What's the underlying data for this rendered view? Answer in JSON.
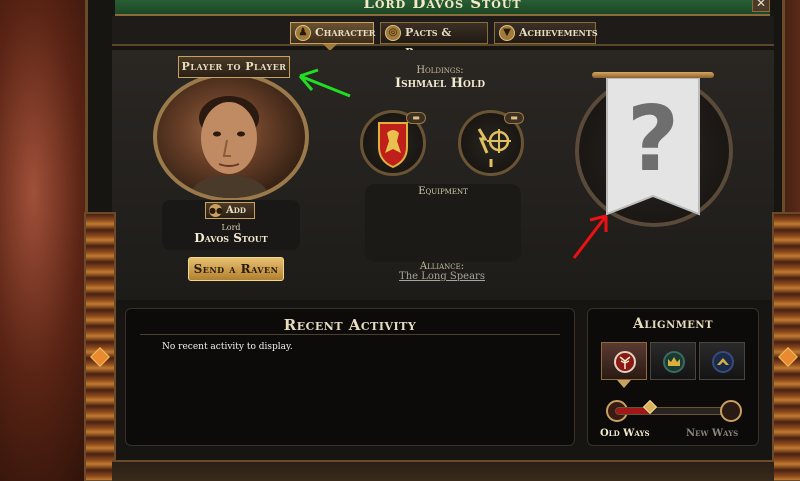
{
  "window": {
    "title": "Lord Davos Stout",
    "close_label": "✕"
  },
  "tabs": [
    {
      "label": "Character",
      "icon": "person-icon",
      "active": true
    },
    {
      "label": "Pacts & Power",
      "icon": "rings-icon",
      "active": false
    },
    {
      "label": "Achievements",
      "icon": "trophy-icon",
      "active": false
    }
  ],
  "character": {
    "player_to_player_label": "Player to Player",
    "add_label": "Add",
    "title_prefix": "Lord",
    "name": "Davos Stout",
    "send_raven_label": "Send a Raven"
  },
  "holdings": {
    "label": "Holdings:",
    "value": "Ishmael Hold"
  },
  "equipment": {
    "label": "Equipment"
  },
  "alliance": {
    "label": "Alliance:",
    "value": "The Long Spears"
  },
  "banner": {
    "symbol": "?"
  },
  "recent_activity": {
    "title": "Recent Activity",
    "empty_text": "No recent activity to display."
  },
  "alignment": {
    "title": "Alignment",
    "options": [
      {
        "icon": "weirwood-tree-icon",
        "selected": true
      },
      {
        "icon": "crown-icon",
        "selected": false
      },
      {
        "icon": "chevron-up-icon",
        "selected": false
      }
    ],
    "left_label": "Old Ways",
    "right_label": "New Ways",
    "slider_level": 0.3
  },
  "colors": {
    "title_bar": "#2f6a3c",
    "accent_gold": "#c8a060",
    "annotation_green": "#22dd22",
    "annotation_red": "#ee1111",
    "old_ways_red": "#a01818"
  }
}
